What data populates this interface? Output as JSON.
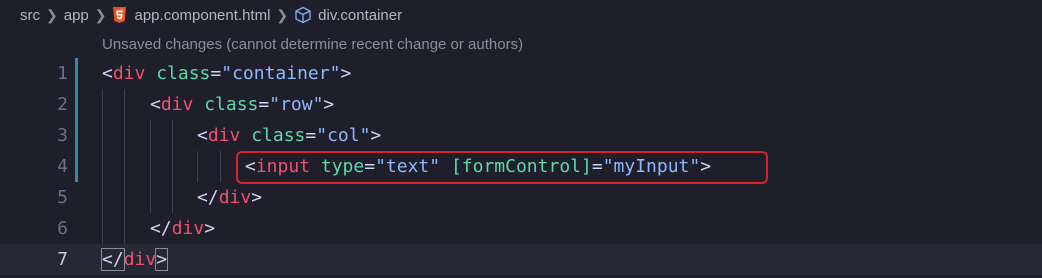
{
  "breadcrumb": {
    "items": [
      "src",
      "app",
      "app.component.html",
      "div.container"
    ],
    "icons": [
      "html5-icon",
      "cube-icon"
    ]
  },
  "codelens": "Unsaved changes (cannot determine recent change or authors)",
  "editor": {
    "lines": [
      {
        "num": "1",
        "tokens": [
          [
            "<",
            "p"
          ],
          [
            "div",
            "t"
          ],
          [
            " ",
            "p"
          ],
          [
            "class",
            "a"
          ],
          [
            "=",
            "e"
          ],
          [
            "\"container\"",
            "s"
          ],
          [
            ">",
            "p"
          ]
        ]
      },
      {
        "num": "2",
        "tokens": [
          [
            "<",
            "p"
          ],
          [
            "div",
            "t"
          ],
          [
            " ",
            "p"
          ],
          [
            "class",
            "a"
          ],
          [
            "=",
            "e"
          ],
          [
            "\"row\"",
            "s"
          ],
          [
            ">",
            "p"
          ]
        ]
      },
      {
        "num": "3",
        "tokens": [
          [
            "<",
            "p"
          ],
          [
            "div",
            "t"
          ],
          [
            " ",
            "p"
          ],
          [
            "class",
            "a"
          ],
          [
            "=",
            "e"
          ],
          [
            "\"col\"",
            "s"
          ],
          [
            ">",
            "p"
          ]
        ]
      },
      {
        "num": "4",
        "tokens": [
          [
            "<",
            "p"
          ],
          [
            "input",
            "t"
          ],
          [
            " ",
            "p"
          ],
          [
            "type",
            "a"
          ],
          [
            "=",
            "e"
          ],
          [
            "\"text\"",
            "s"
          ],
          [
            " ",
            "p"
          ],
          [
            "[formControl]",
            "a"
          ],
          [
            "=",
            "e"
          ],
          [
            "\"myInput\"",
            "s"
          ],
          [
            ">",
            "p"
          ]
        ]
      },
      {
        "num": "5",
        "tokens": [
          [
            "</",
            "p"
          ],
          [
            "div",
            "t"
          ],
          [
            ">",
            "p"
          ]
        ]
      },
      {
        "num": "6",
        "tokens": [
          [
            "</",
            "p"
          ],
          [
            "div",
            "t"
          ],
          [
            ">",
            "p"
          ]
        ]
      },
      {
        "num": "7",
        "tokens": [
          [
            "</",
            "p"
          ],
          [
            "div",
            "t"
          ],
          [
            ">",
            "p"
          ]
        ]
      }
    ]
  },
  "colors": {
    "tag": "#f0506e",
    "attribute": "#5fd9a4",
    "string": "#8fb8ff",
    "highlight": "#d7222a"
  }
}
